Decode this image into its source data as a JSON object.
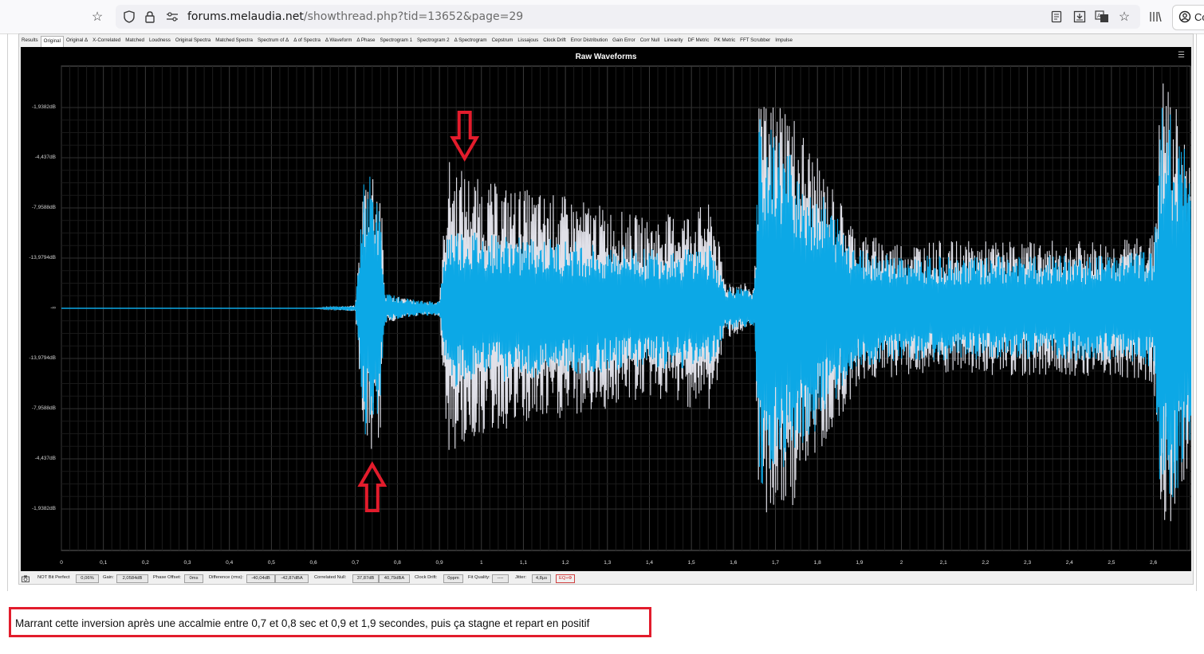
{
  "browser": {
    "url_domain": "forums.melaudia.net",
    "url_path": "/showthread.php?tid=13652&page=29",
    "account_label": "Co",
    "icons": [
      "star-icon",
      "shield-icon",
      "lock-icon",
      "permissions-icon",
      "reader-icon",
      "save-icon",
      "translate-icon",
      "bookmark-star-icon",
      "library-icon",
      "account-icon"
    ]
  },
  "tabs": [
    "Results",
    "Original",
    "Original Δ",
    "X-Correlated",
    "Matched",
    "Loudness",
    "Original Spectra",
    "Matched Spectra",
    "Spectrum of Δ",
    "Δ of Spectra",
    "Δ Waveform",
    "Δ Phase",
    "Spectrogram 1",
    "Spectrogram 2",
    "Δ Spectrogram",
    "Cepstrum",
    "Lissajous",
    "Clock Drift",
    "Error Distribution",
    "Gain Error",
    "Corr Null",
    "Linearity",
    "DF Metric",
    "PK Metric",
    "FFT Scrubber",
    "Impulse"
  ],
  "active_tab": "Original",
  "chart_data": {
    "type": "line",
    "title": "Raw Waveforms",
    "xlabel": "",
    "ylabel": "",
    "y_tick_labels": [
      "-1,9382dB",
      "-4,437dB",
      "-7,9588dB",
      "-13,9794dB",
      "-∞",
      "-13,9794dB",
      "-7,9588dB",
      "-4,437dB",
      "-1,9382dB"
    ],
    "x_ticks": [
      "0",
      "0,1",
      "0,2",
      "0,3",
      "0,4",
      "0,5",
      "0,6",
      "0,7",
      "0,8",
      "0,9",
      "1",
      "1,1",
      "1,2",
      "1,3",
      "1,4",
      "1,5",
      "1,6",
      "1,7",
      "1,8",
      "1,9",
      "2",
      "2,1",
      "2,2",
      "2,3",
      "2,4",
      "2,5",
      "2,6"
    ],
    "xlim": [
      0,
      2.69
    ],
    "ylim": [
      -1,
      1
    ],
    "grid": true,
    "series": [
      {
        "color": "#e0e0e8",
        "envelope": [
          [
            0,
            0
          ],
          [
            0.6,
            0
          ],
          [
            0.7,
            0.02
          ],
          [
            0.72,
            0.9
          ],
          [
            0.74,
            1.0
          ],
          [
            0.76,
            0.85
          ],
          [
            0.77,
            0.1
          ],
          [
            0.85,
            0.05
          ],
          [
            0.9,
            0.05
          ],
          [
            0.92,
            1.0
          ],
          [
            1.0,
            0.85
          ],
          [
            1.2,
            0.75
          ],
          [
            1.4,
            0.6
          ],
          [
            1.55,
            0.7
          ],
          [
            1.58,
            0.2
          ],
          [
            1.65,
            0.15
          ],
          [
            1.66,
            1.35
          ],
          [
            1.72,
            1.45
          ],
          [
            1.8,
            1.0
          ],
          [
            1.9,
            0.5
          ],
          [
            2.0,
            0.45
          ],
          [
            2.5,
            0.45
          ],
          [
            2.6,
            0.5
          ],
          [
            2.62,
            1.6
          ],
          [
            2.66,
            1.3
          ],
          [
            2.69,
            1.0
          ]
        ]
      },
      {
        "color": "#0ca8e6",
        "envelope": [
          [
            0,
            0
          ],
          [
            0.6,
            0
          ],
          [
            0.7,
            0.02
          ],
          [
            0.72,
            0.85
          ],
          [
            0.74,
            0.9
          ],
          [
            0.76,
            0.6
          ],
          [
            0.77,
            0.1
          ],
          [
            0.85,
            0.05
          ],
          [
            0.9,
            0.05
          ],
          [
            0.92,
            0.55
          ],
          [
            1.0,
            0.5
          ],
          [
            1.2,
            0.45
          ],
          [
            1.4,
            0.4
          ],
          [
            1.55,
            0.42
          ],
          [
            1.58,
            0.15
          ],
          [
            1.65,
            0.12
          ],
          [
            1.66,
            1.3
          ],
          [
            1.72,
            1.1
          ],
          [
            1.8,
            0.8
          ],
          [
            1.9,
            0.4
          ],
          [
            2.0,
            0.35
          ],
          [
            2.5,
            0.35
          ],
          [
            2.6,
            0.4
          ],
          [
            2.62,
            1.4
          ],
          [
            2.66,
            1.2
          ],
          [
            2.69,
            0.9
          ]
        ]
      }
    ],
    "annotations": [
      {
        "shape": "arrow-down",
        "color": "#e21c2c",
        "x": 0.96,
        "y": 1.6
      },
      {
        "shape": "arrow-up",
        "color": "#e21c2c",
        "x": 0.74,
        "y": -1.5
      }
    ]
  },
  "status": {
    "bit_perfect": "NOT Bit Perfect",
    "bit_perfect_value": "0,06%",
    "gain_label": "Gain:",
    "gain_value": "2,0584dB",
    "phase_label": "Phase Offset:",
    "phase_value": "0ms",
    "diff_label": "Difference (rms):",
    "diff_value1": "-40,04dB",
    "diff_value2": "-42,87dBA",
    "corr_label": "Correlated Null:",
    "corr_value1": "37,87dB",
    "corr_value2": "40,79dBA",
    "clock_label": "Clock Drift:",
    "clock_value": "0ppm",
    "fit_label": "Fit Quality:",
    "fit_value": "----",
    "jitter_label": "Jitter:",
    "jitter_value": "4,8μs",
    "eq_label": "EQ+Φ"
  },
  "caption": "Marrant cette inversion après une accalmie entre 0,7 et 0,8 sec et 0,9 et 1,9 secondes, puis ça stagne et repart en positif",
  "colors": {
    "accent_red": "#e21c2c",
    "waveform_blue": "#0ca8e6",
    "waveform_white": "#e0e0e8"
  }
}
